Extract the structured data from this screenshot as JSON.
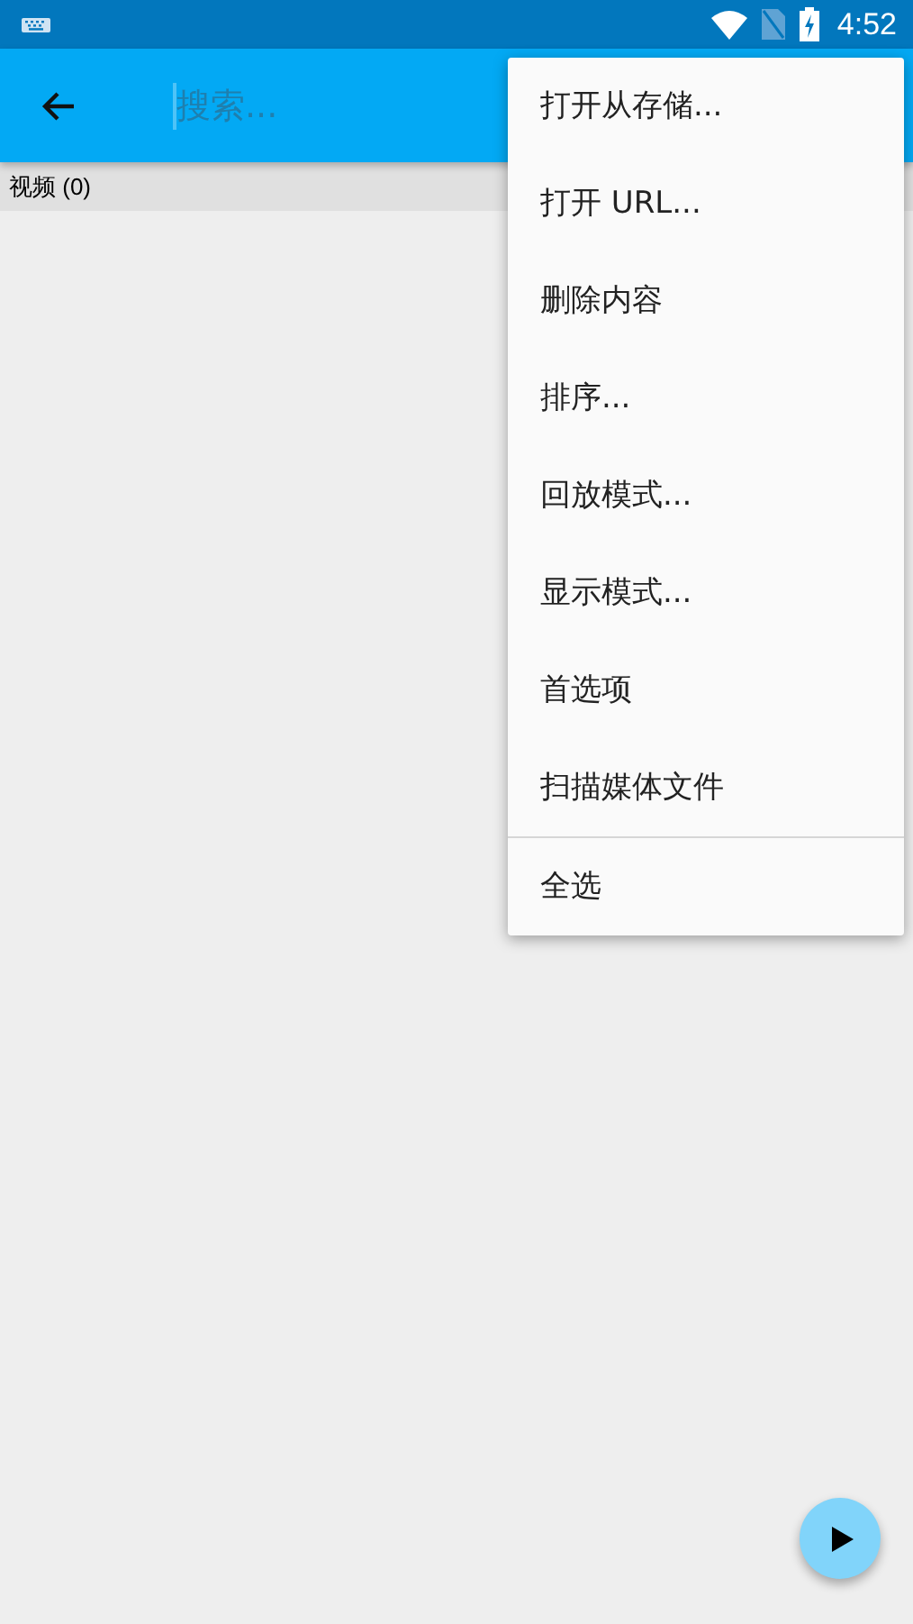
{
  "status_bar": {
    "time": "4:52"
  },
  "toolbar": {
    "search": {
      "placeholder": "搜索..."
    }
  },
  "section_header": "视频 (0)",
  "menu": {
    "groups": [
      [
        "打开从存储...",
        "打开 URL...",
        "删除内容",
        "排序...",
        "回放模式...",
        "显示模式...",
        "首选项",
        "扫描媒体文件"
      ],
      [
        "全选"
      ]
    ]
  }
}
